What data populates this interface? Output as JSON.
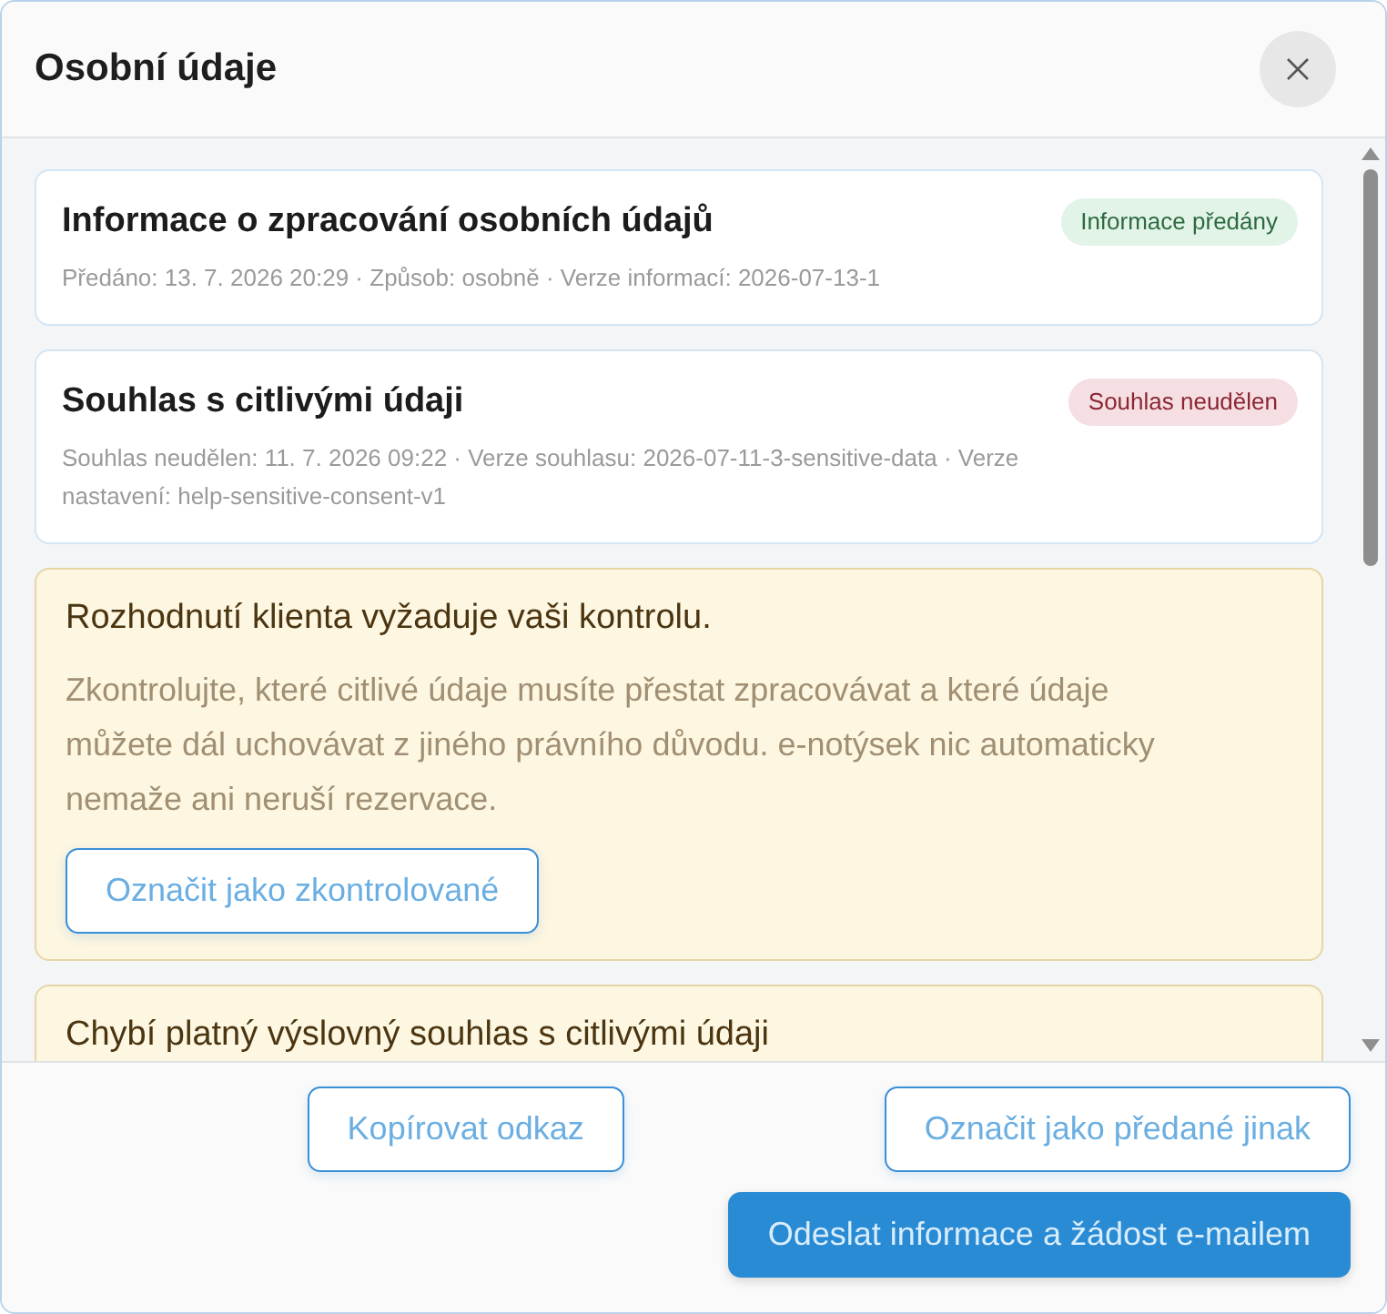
{
  "dialog": {
    "title": "Osobní údaje"
  },
  "items": [
    {
      "kind": "record",
      "title": "Informace o zpracování osobních údajů",
      "details": "Předáno: 13. 7. 2026 20:29 · Způsob: osobně · Verze informací: 2026-07-13-1",
      "badge": {
        "label": "Informace předány",
        "color": "#2d6a40"
      }
    },
    {
      "kind": "record",
      "title": "Souhlas s citlivými údaji",
      "details": "Souhlas neudělen: 11. 7. 2026 09:22 · Verze souhlasu: 2026-07-11-3-sensitive-data · Verze nastavení: help-sensitive-consent-v1",
      "badge": {
        "label": "Souhlas neudělen",
        "color": "#8b2633"
      }
    },
    {
      "kind": "notice",
      "title": "Rozhodnutí klienta vyžaduje vaši kontrolu.",
      "text": "Zkontrolujte, které citlivé údaje musíte přestat zpracovávat a které údaje můžete dál uchovávat z jiného právního důvodu. e-notýsek nic automaticky nemaže ani neruší rezervace.",
      "button": {
        "label": "Označit jako zkontrolované"
      }
    },
    {
      "kind": "notice",
      "title": "Chybí platný výslovný souhlas s citlivými údaji"
    }
  ],
  "footer": {
    "button_rows": [
      [
        {
          "label": "Kopírovat odkaz",
          "kind": "outline"
        },
        {
          "label": "Označit jako předané jinak",
          "kind": "outline"
        }
      ],
      [
        {
          "label": "Odeslat informace a žádost e-mailem",
          "kind": "primary"
        }
      ]
    ]
  }
}
